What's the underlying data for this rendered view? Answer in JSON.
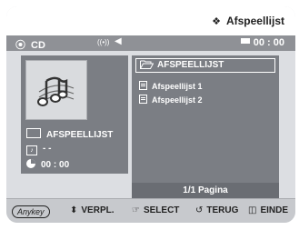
{
  "title": {
    "icon": "diamond-icon",
    "text": "Afspeellijst"
  },
  "status": {
    "disc_icon": "disc-icon",
    "disc_label": "CD",
    "surround_icon": "surround-icon",
    "surround_text": "((•))",
    "speaker_icon": "speaker-icon",
    "time_icon": "time-bar-icon",
    "time": "00 : 00"
  },
  "thumbnail": {
    "icon": "music-notes-icon"
  },
  "info": {
    "folder_icon": "folder-icon",
    "folder_name": "AFSPEELLIJST",
    "track_icon": "track-icon",
    "track": "- -",
    "clock_icon": "clock-icon",
    "time": "00 : 00"
  },
  "browser": {
    "current_folder_icon": "open-folder-icon",
    "current_folder": "AFSPEELLIJST",
    "items": [
      {
        "icon": "playlist-icon",
        "label": "Afspeellijst 1"
      },
      {
        "icon": "playlist-icon",
        "label": "Afspeellijst 2"
      }
    ],
    "page_label": "1/1 Pagina"
  },
  "bottom": {
    "anykey": "Anykey",
    "move_symbol": "⬍",
    "move_label": "VERPL.",
    "select_symbol": "☞",
    "select_label": "SELECT",
    "back_symbol": "↺",
    "back_label": "TERUG",
    "exit_symbol": "◫",
    "exit_label": "EINDE"
  }
}
